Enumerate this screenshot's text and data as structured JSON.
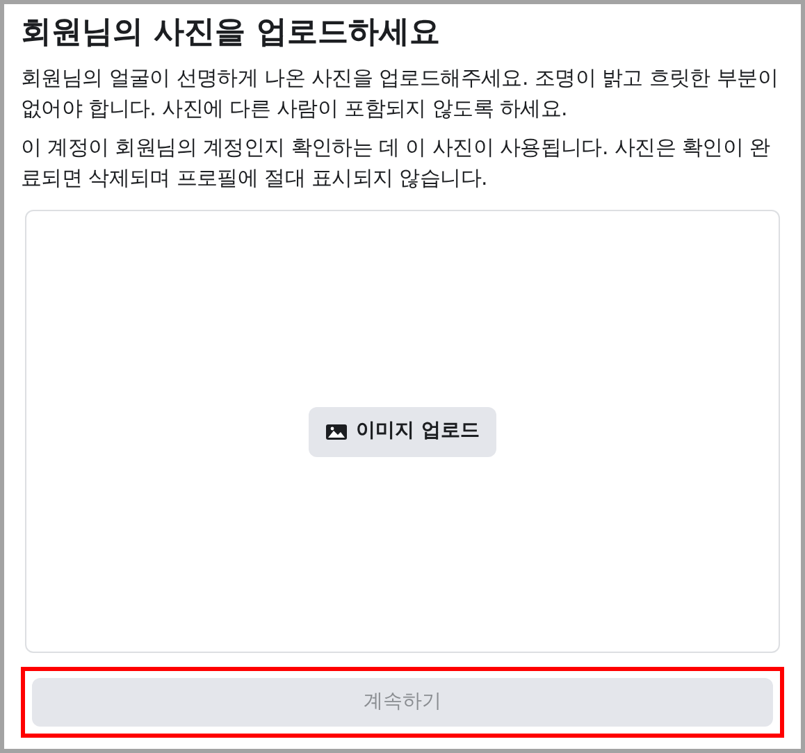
{
  "title": "회원님의 사진을 업로드하세요",
  "paragraphs": [
    "회원님의 얼굴이 선명하게 나온 사진을 업로드해주세요. 조명이 밝고 흐릿한 부분이 없어야 합니다. 사진에 다른 사람이 포함되지 않도록 하세요.",
    "이 계정이 회원님의 계정인지 확인하는 데 이 사진이 사용됩니다. 사진은 확인이 완료되면 삭제되며 프로필에 절대 표시되지 않습니다."
  ],
  "upload_button": {
    "label": "이미지 업로드"
  },
  "continue_button": {
    "label": "계속하기",
    "disabled": true,
    "highlighted": true
  }
}
